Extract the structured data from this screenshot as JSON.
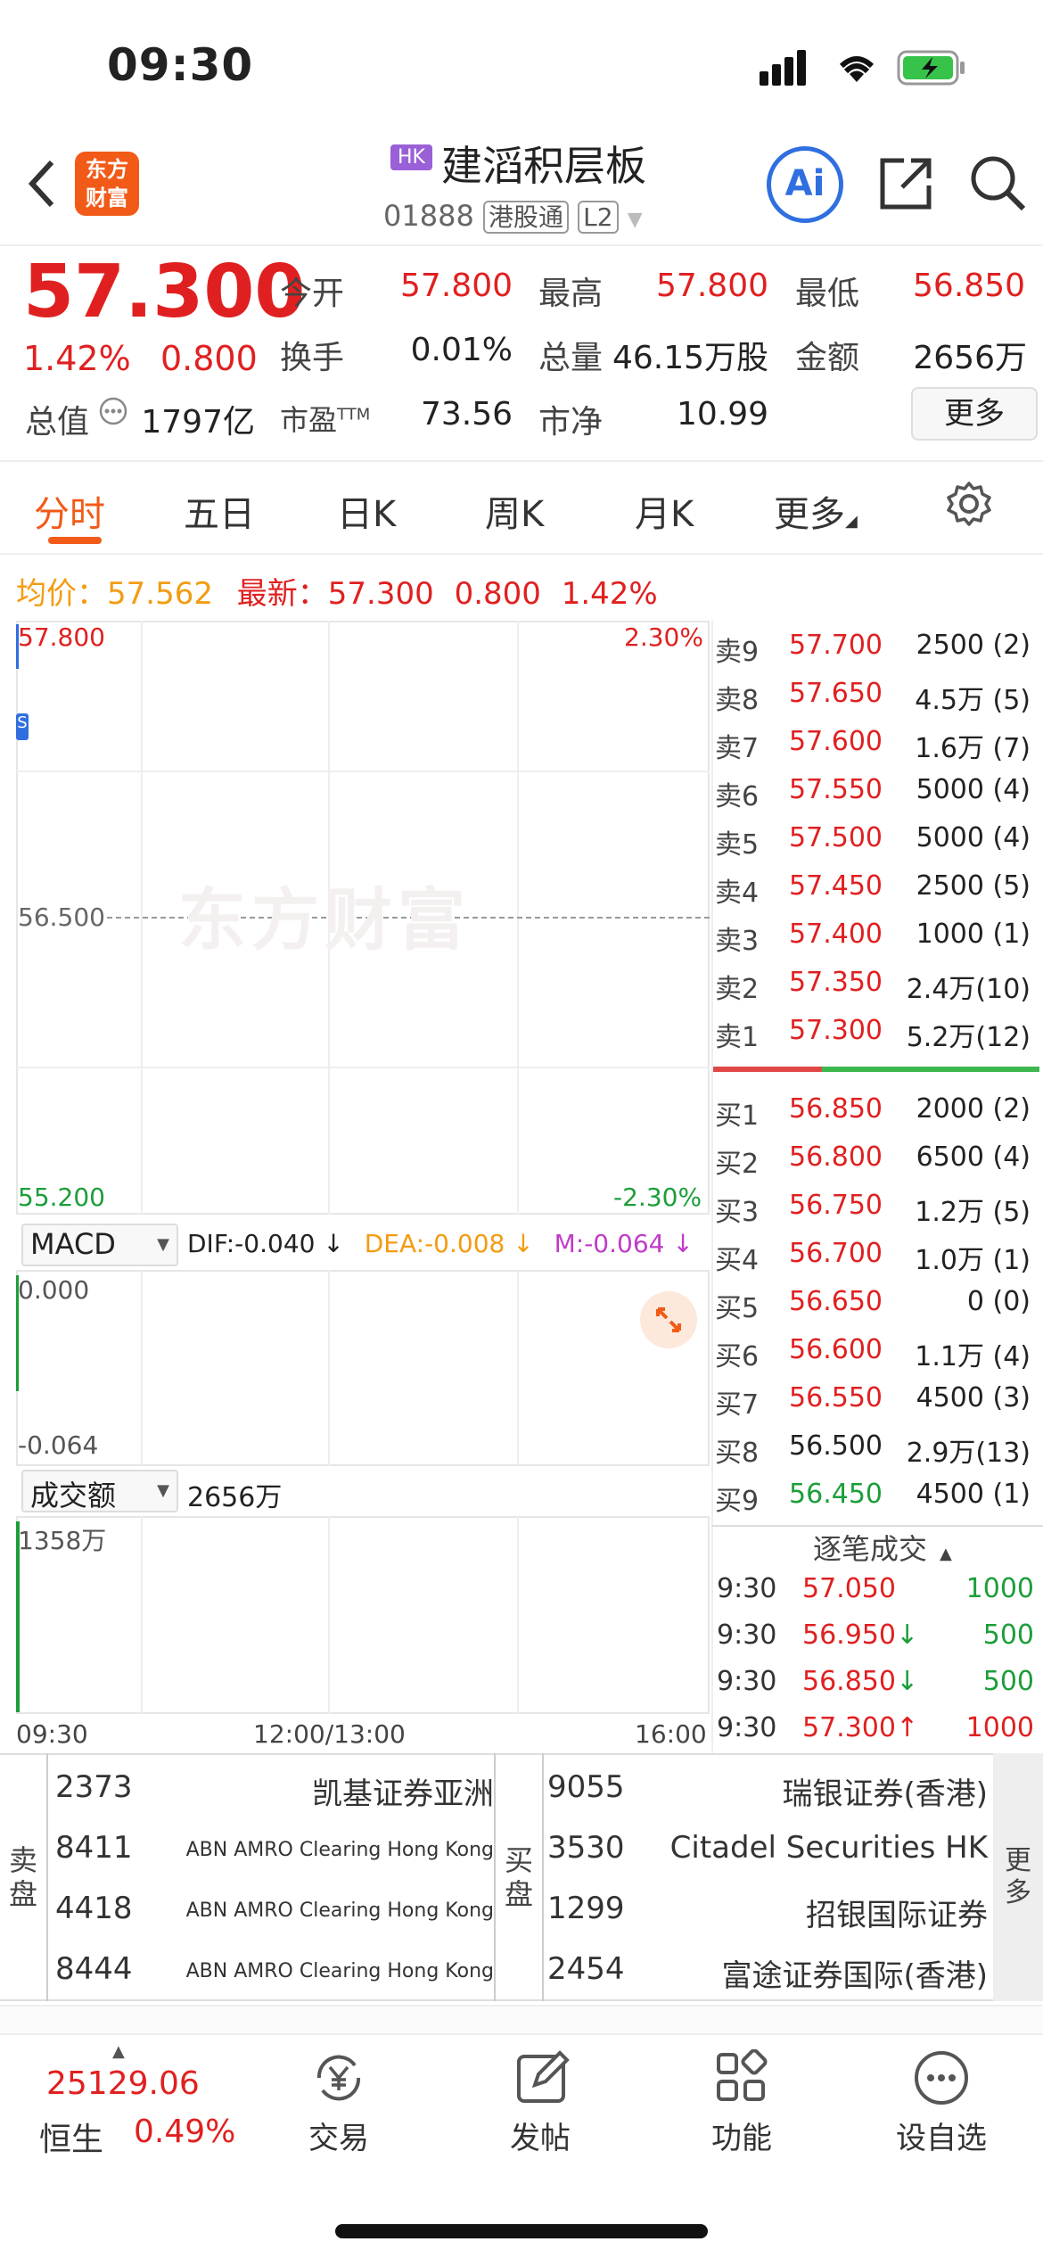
{
  "status_bar": {
    "time": "09:30"
  },
  "header": {
    "logo_text": [
      "东方",
      "财富"
    ],
    "market_tag": "HK",
    "stock_name": "建滔积层板",
    "stock_code": "01888",
    "badge_connect": "港股通",
    "badge_level": "L2",
    "ai_label": "Ai"
  },
  "quote": {
    "price": "57.300",
    "change_pct": "1.42%",
    "change_val": "0.800",
    "rows": [
      [
        {
          "label": "今开",
          "value": "57.800",
          "color": "red"
        },
        {
          "label": "最高",
          "value": "57.800",
          "color": "red"
        },
        {
          "label": "最低",
          "value": "56.850",
          "color": "red"
        }
      ],
      [
        {
          "label": "换手",
          "value": "0.01%",
          "color": "dark"
        },
        {
          "label": "总量",
          "value": "46.15万股",
          "color": "dark"
        },
        {
          "label": "金额",
          "value": "2656万",
          "color": "dark"
        }
      ],
      [
        {
          "label": "市盈",
          "value": "73.56",
          "color": "dark",
          "sup": "TTM"
        },
        {
          "label": "市净",
          "value": "10.99",
          "color": "dark"
        }
      ]
    ],
    "market_cap_label": "总值",
    "market_cap": "1797亿",
    "more_label": "更多"
  },
  "tabs": [
    "分时",
    "五日",
    "日K",
    "周K",
    "月K",
    "更多"
  ],
  "active_tab": 0,
  "avg_line": {
    "avg_label": "均价：",
    "avg": "57.562",
    "latest_label": "最新：",
    "latest": "57.300",
    "change": "0.800",
    "pct": "1.42%"
  },
  "chart": {
    "y_top": "57.800",
    "y_mid": "56.500",
    "y_bottom": "55.200",
    "pct_top": "2.30%",
    "pct_bottom": "-2.30%",
    "watermark": "东方财富",
    "x_labels": [
      "09:30",
      "12:00/13:00",
      "16:00"
    ]
  },
  "macd": {
    "label": "MACD",
    "dif": "DIF:-0.040 ↓",
    "dea": "DEA:-0.008 ↓",
    "m": "M:-0.064 ↓",
    "top": "0.000",
    "bottom": "-0.064"
  },
  "volume": {
    "label": "成交额",
    "value": "2656万",
    "top": "1358万"
  },
  "order_book": {
    "asks": [
      {
        "label": "卖9",
        "price": "57.700",
        "vol": "2500 (2)"
      },
      {
        "label": "卖8",
        "price": "57.650",
        "vol": "4.5万 (5)"
      },
      {
        "label": "卖7",
        "price": "57.600",
        "vol": "1.6万 (7)"
      },
      {
        "label": "卖6",
        "price": "57.550",
        "vol": "5000 (4)"
      },
      {
        "label": "卖5",
        "price": "57.500",
        "vol": "5000 (4)"
      },
      {
        "label": "卖4",
        "price": "57.450",
        "vol": "2500 (5)"
      },
      {
        "label": "卖3",
        "price": "57.400",
        "vol": "1000 (1)"
      },
      {
        "label": "卖2",
        "price": "57.350",
        "vol": "2.4万(10)"
      },
      {
        "label": "卖1",
        "price": "57.300",
        "vol": "5.2万(12)"
      }
    ],
    "bids": [
      {
        "label": "买1",
        "price": "56.850",
        "vol": "2000 (2)",
        "color": "red"
      },
      {
        "label": "买2",
        "price": "56.800",
        "vol": "6500 (4)",
        "color": "red"
      },
      {
        "label": "买3",
        "price": "56.750",
        "vol": "1.2万 (5)",
        "color": "red"
      },
      {
        "label": "买4",
        "price": "56.700",
        "vol": "1.0万 (1)",
        "color": "red"
      },
      {
        "label": "买5",
        "price": "56.650",
        "vol": "0 (0)",
        "color": "red"
      },
      {
        "label": "买6",
        "price": "56.600",
        "vol": "1.1万 (4)",
        "color": "red"
      },
      {
        "label": "买7",
        "price": "56.550",
        "vol": "4500 (3)",
        "color": "red"
      },
      {
        "label": "买8",
        "price": "56.500",
        "vol": "2.9万(13)",
        "color": "dark"
      },
      {
        "label": "买9",
        "price": "56.450",
        "vol": "4500 (1)",
        "color": "green"
      }
    ],
    "ratio_sell": 0.32
  },
  "ticks": {
    "title": "逐笔成交",
    "rows": [
      {
        "time": "9:30",
        "price": "57.050",
        "arrow": "",
        "vol": "1000",
        "color": "red"
      },
      {
        "time": "9:30",
        "price": "56.950",
        "arrow": "↓",
        "vol": "500",
        "color": "red"
      },
      {
        "time": "9:30",
        "price": "56.850",
        "arrow": "↓",
        "vol": "500",
        "color": "red"
      },
      {
        "time": "9:30",
        "price": "57.300",
        "arrow": "↑",
        "vol": "1000",
        "color": "red"
      }
    ]
  },
  "brokers": {
    "sell_label": "卖盘",
    "buy_label": "买盘",
    "more_label": "更多",
    "sell": [
      {
        "id": "2373",
        "name": "凯基证券亚洲",
        "small": false
      },
      {
        "id": "8411",
        "name": "ABN AMRO Clearing Hong Kong",
        "small": true
      },
      {
        "id": "4418",
        "name": "ABN AMRO Clearing Hong Kong",
        "small": true
      },
      {
        "id": "8444",
        "name": "ABN AMRO Clearing Hong Kong",
        "small": true
      }
    ],
    "buy": [
      {
        "id": "9055",
        "name": "瑞银证券(香港)"
      },
      {
        "id": "3530",
        "name": "Citadel Securities HK"
      },
      {
        "id": "1299",
        "name": "招银国际证券"
      },
      {
        "id": "2454",
        "name": "富途证券国际(香港)"
      }
    ]
  },
  "tab_bar": {
    "index_value": "25129.06",
    "index_name": "恒生",
    "index_pct": "0.49%",
    "items": [
      {
        "label": "交易",
        "icon": "yen-exchange-icon"
      },
      {
        "label": "发帖",
        "icon": "edit-icon"
      },
      {
        "label": "功能",
        "icon": "grid-icon"
      },
      {
        "label": "设自选",
        "icon": "more-dots-icon"
      }
    ]
  },
  "colors": {
    "red": "#e02020",
    "green": "#1c9e3a",
    "orange": "#f39c12",
    "accent": "#f25a17",
    "ai": "#2f6fe0"
  }
}
